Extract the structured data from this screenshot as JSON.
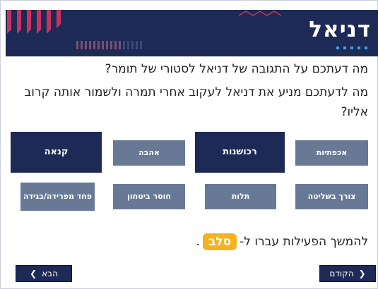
{
  "header": {
    "title": "דניאל"
  },
  "questions": {
    "q1": "מה דעתכם על התגובה של דניאל לסטורי של תומר?",
    "q2": "מה לדעתכם מניע את דניאל לעקוב אחרי תמרה ולשמור אותה קרוב אליו?"
  },
  "options": {
    "row1": [
      "אכפתיות",
      "רכושנות",
      "אהבה",
      "קנאה"
    ],
    "row2": [
      "צורך בשליטה",
      "תלות",
      "חוסר ביטחון",
      "פחד מפרידה/בגידה"
    ]
  },
  "continue": {
    "text_before": "להמשך הפעילות עברו ל-",
    "badge": "סלב",
    "text_after": "."
  },
  "nav": {
    "prev_label": "הקודם",
    "next_label": "הבא"
  },
  "colors": {
    "navy": "#1d2a55",
    "gray": "#687996",
    "accent": "#f4b223",
    "stripes": "#c8325f"
  }
}
